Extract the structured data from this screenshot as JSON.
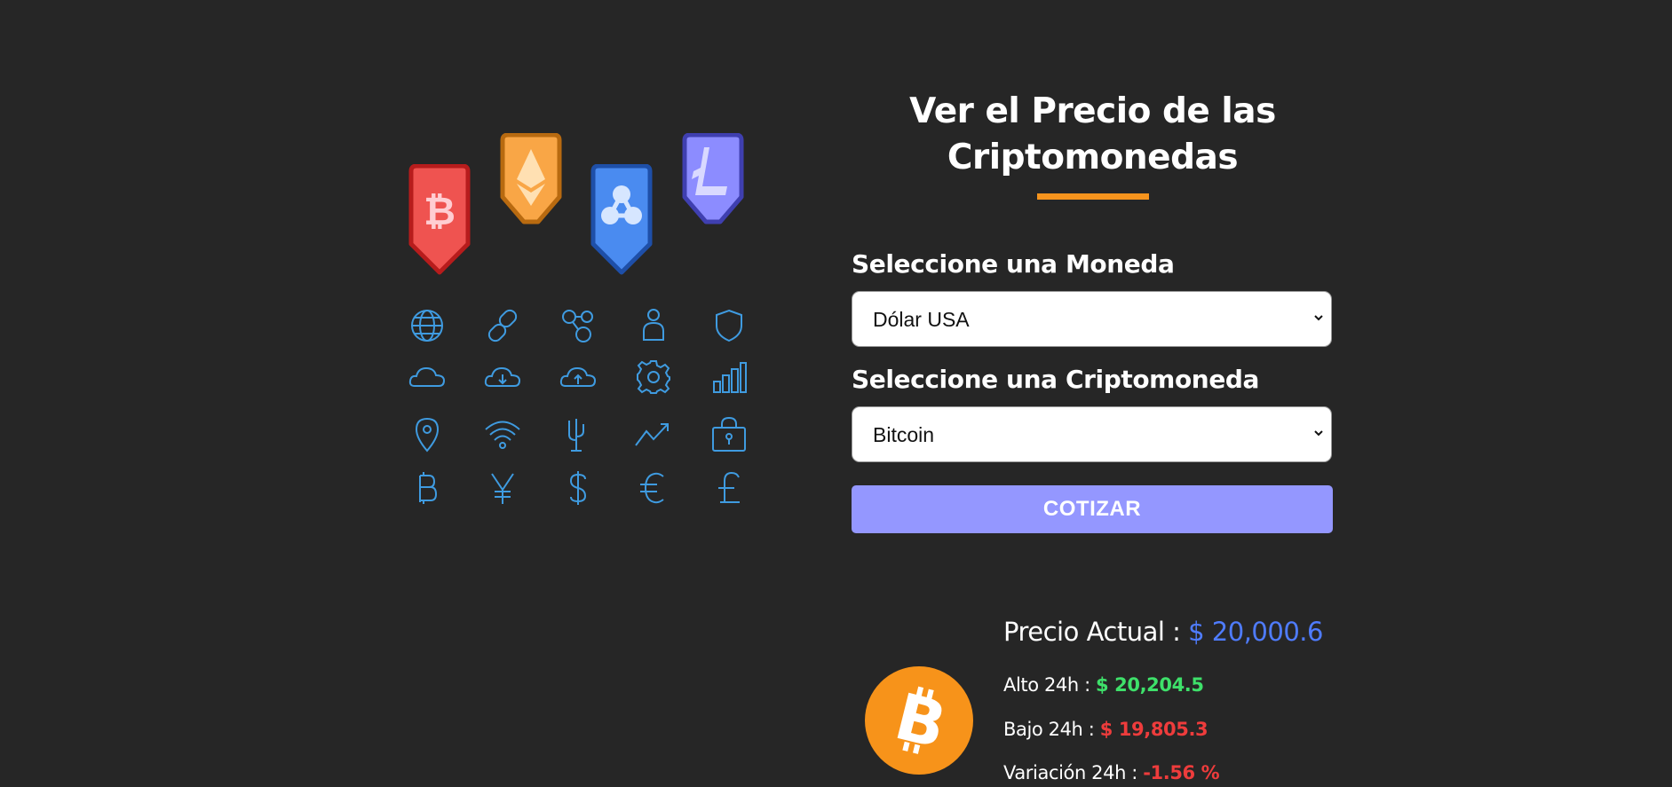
{
  "header": {
    "title_line1": "Ver el Precio de las",
    "title_line2": "Criptomonedas"
  },
  "form": {
    "currency_label": "Seleccione una Moneda",
    "currency_selected": "Dólar USA",
    "crypto_label": "Seleccione una Criptomoneda",
    "crypto_selected": "Bitcoin",
    "submit_label": "COTIZAR"
  },
  "result": {
    "price_label": "Precio Actual :",
    "price_value": "$ 20,000.6",
    "high_label": "Alto 24h :",
    "high_value": "$ 20,204.5",
    "low_label": "Bajo 24h :",
    "low_value": "$ 19,805.3",
    "change_label": "Variación 24h :",
    "change_value": "-1.56 %"
  },
  "illustration": {
    "badges": [
      "bitcoin-badge-icon",
      "ethereum-badge-icon",
      "ripple-badge-icon",
      "litecoin-badge-icon"
    ],
    "grid_icons": [
      "globe-icon",
      "link-icon",
      "network-nodes-icon",
      "user-icon",
      "shield-icon",
      "cloud-icon",
      "cloud-download-icon",
      "cloud-upload-icon",
      "gear-icon",
      "bar-chart-icon",
      "location-pin-icon",
      "wifi-icon",
      "usb-icon",
      "trend-up-icon",
      "lock-icon",
      "bitcoin-icon",
      "yen-icon",
      "dollar-icon",
      "euro-icon",
      "pound-icon"
    ]
  },
  "colors": {
    "background": "#262626",
    "accent_orange": "#f7941d",
    "button": "#9497ff",
    "price_blue": "#4f7cff",
    "up_green": "#3ee06a",
    "down_red": "#ee3c3c",
    "icon_blue": "#3f9be0"
  }
}
